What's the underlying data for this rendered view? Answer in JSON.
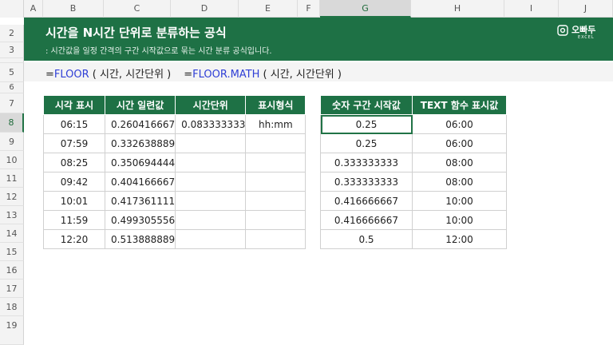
{
  "columns": [
    "A",
    "B",
    "C",
    "D",
    "E",
    "F",
    "G",
    "H",
    "I",
    "J"
  ],
  "active_column": "G",
  "rows": [
    "2",
    "3",
    "5",
    "6",
    "7",
    "8",
    "9",
    "10",
    "11",
    "12",
    "13",
    "14",
    "15",
    "16",
    "17",
    "18",
    "19"
  ],
  "active_row": "8",
  "banner": {
    "title": "시간을 N시간 단위로 분류하는 공식",
    "subtitle": ": 시간값을 일정 간격의 구간 시작값으로 묶는 시간 분류 공식입니다.",
    "logo_text": "오빠두",
    "logo_sub": "EXCEL",
    "accent_color": "#1e7145"
  },
  "formula": {
    "f1_eq": "=",
    "f1_name": "FLOOR",
    "f1_args": " ( 시간, 시간단위 )",
    "f2_eq": "=",
    "f2_name": "FLOOR.MATH",
    "f2_args": " ( 시간, 시간단위 )"
  },
  "table1": {
    "headers": [
      "시각 표시",
      "시간 일련값",
      "시간단위",
      "표시형식"
    ],
    "rows": [
      [
        "06:15",
        "0.260416667",
        "0.083333333",
        "hh:mm"
      ],
      [
        "07:59",
        "0.332638889",
        "",
        ""
      ],
      [
        "08:25",
        "0.350694444",
        "",
        ""
      ],
      [
        "09:42",
        "0.404166667",
        "",
        ""
      ],
      [
        "10:01",
        "0.417361111",
        "",
        ""
      ],
      [
        "11:59",
        "0.499305556",
        "",
        ""
      ],
      [
        "12:20",
        "0.513888889",
        "",
        ""
      ]
    ]
  },
  "table2": {
    "headers": [
      "숫자 구간 시작값",
      "TEXT 함수 표시값"
    ],
    "rows": [
      [
        "0.25",
        "06:00"
      ],
      [
        "0.25",
        "06:00"
      ],
      [
        "0.333333333",
        "08:00"
      ],
      [
        "0.333333333",
        "08:00"
      ],
      [
        "0.416666667",
        "10:00"
      ],
      [
        "0.416666667",
        "10:00"
      ],
      [
        "0.5",
        "12:00"
      ]
    ]
  }
}
